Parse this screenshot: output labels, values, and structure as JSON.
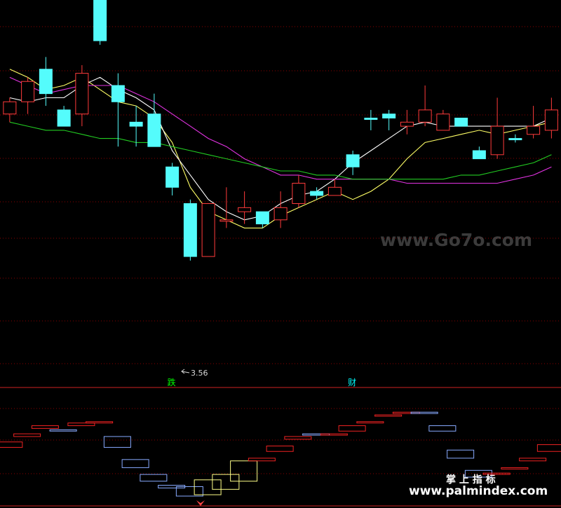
{
  "chart_data": {
    "type": "candlestick",
    "main_panel": {
      "price_range": [
        3.35,
        4.3
      ],
      "min_label": "3.56",
      "grid": true,
      "candles": [
        {
          "o": 4.05,
          "c": 4.02,
          "h": 4.06,
          "l": 4.0,
          "dir": "up"
        },
        {
          "o": 4.05,
          "c": 4.1,
          "h": 4.11,
          "l": 4.02,
          "dir": "up"
        },
        {
          "o": 4.13,
          "c": 4.07,
          "h": 4.16,
          "l": 4.04,
          "dir": "down"
        },
        {
          "o": 4.03,
          "c": 3.99,
          "h": 4.04,
          "l": 3.99,
          "dir": "down"
        },
        {
          "o": 4.02,
          "c": 4.12,
          "h": 4.14,
          "l": 3.99,
          "dir": "up"
        },
        {
          "o": 4.36,
          "c": 4.2,
          "h": 4.36,
          "l": 4.19,
          "dir": "down"
        },
        {
          "o": 4.09,
          "c": 4.05,
          "h": 4.12,
          "l": 3.94,
          "dir": "down"
        },
        {
          "o": 4.0,
          "c": 3.99,
          "h": 4.04,
          "l": 3.94,
          "dir": "down"
        },
        {
          "o": 4.02,
          "c": 3.94,
          "h": 4.07,
          "l": 3.94,
          "dir": "down"
        },
        {
          "o": 3.89,
          "c": 3.84,
          "h": 3.9,
          "l": 3.82,
          "dir": "down"
        },
        {
          "o": 3.8,
          "c": 3.67,
          "h": 3.81,
          "l": 3.66,
          "dir": "down"
        },
        {
          "o": 3.67,
          "c": 3.8,
          "h": 3.8,
          "l": 3.67,
          "dir": "up"
        },
        {
          "o": 3.76,
          "c": 3.76,
          "h": 3.84,
          "l": 3.74,
          "dir": "up"
        },
        {
          "o": 3.78,
          "c": 3.79,
          "h": 3.83,
          "l": 3.75,
          "dir": "up"
        },
        {
          "o": 3.78,
          "c": 3.75,
          "h": 3.78,
          "l": 3.74,
          "dir": "down"
        },
        {
          "o": 3.76,
          "c": 3.79,
          "h": 3.83,
          "l": 3.74,
          "dir": "up"
        },
        {
          "o": 3.8,
          "c": 3.85,
          "h": 3.87,
          "l": 3.79,
          "dir": "up"
        },
        {
          "o": 3.82,
          "c": 3.83,
          "h": 3.84,
          "l": 3.81,
          "dir": "down"
        },
        {
          "o": 3.82,
          "c": 3.84,
          "h": 3.86,
          "l": 3.82,
          "dir": "up"
        },
        {
          "o": 3.92,
          "c": 3.89,
          "h": 3.93,
          "l": 3.87,
          "dir": "down"
        },
        {
          "o": 4.01,
          "c": 4.01,
          "h": 4.03,
          "l": 3.98,
          "dir": "down"
        },
        {
          "o": 4.02,
          "c": 4.01,
          "h": 4.03,
          "l": 3.98,
          "dir": "down"
        },
        {
          "o": 3.99,
          "c": 4.0,
          "h": 4.03,
          "l": 3.97,
          "dir": "up"
        },
        {
          "o": 4.0,
          "c": 4.03,
          "h": 4.09,
          "l": 3.99,
          "dir": "up"
        },
        {
          "o": 3.98,
          "c": 4.02,
          "h": 4.03,
          "l": 3.98,
          "dir": "up"
        },
        {
          "o": 4.01,
          "c": 3.99,
          "h": 4.01,
          "l": 3.99,
          "dir": "down"
        },
        {
          "o": 3.93,
          "c": 3.91,
          "h": 3.94,
          "l": 3.91,
          "dir": "down"
        },
        {
          "o": 3.92,
          "c": 3.99,
          "h": 4.06,
          "l": 3.91,
          "dir": "up"
        },
        {
          "o": 3.96,
          "c": 3.96,
          "h": 3.97,
          "l": 3.95,
          "dir": "down"
        },
        {
          "o": 3.97,
          "c": 3.99,
          "h": 4.04,
          "l": 3.96,
          "dir": "up"
        },
        {
          "o": 3.98,
          "c": 4.03,
          "h": 4.06,
          "l": 3.96,
          "dir": "up"
        }
      ],
      "ma_lines": {
        "yellow": [
          4.13,
          4.11,
          4.08,
          4.09,
          4.11,
          4.08,
          4.05,
          4.04,
          4.01,
          3.95,
          3.84,
          3.78,
          3.76,
          3.74,
          3.74,
          3.77,
          3.79,
          3.81,
          3.83,
          3.81,
          3.83,
          3.86,
          3.91,
          3.95,
          3.96,
          3.97,
          3.98,
          3.97,
          3.98,
          3.99,
          4.0
        ],
        "white": [
          4.06,
          4.05,
          4.06,
          4.06,
          4.09,
          4.11,
          4.08,
          4.06,
          4.03,
          3.93,
          3.87,
          3.81,
          3.78,
          3.76,
          3.77,
          3.8,
          3.82,
          3.83,
          3.86,
          3.9,
          3.93,
          3.96,
          3.99,
          4.0,
          3.99,
          3.99,
          3.99,
          3.99,
          3.99,
          3.99,
          4.01
        ],
        "magenta": [
          4.11,
          4.09,
          4.07,
          4.08,
          4.09,
          4.09,
          4.09,
          4.07,
          4.05,
          4.02,
          3.99,
          3.96,
          3.94,
          3.91,
          3.89,
          3.87,
          3.87,
          3.86,
          3.86,
          3.86,
          3.86,
          3.86,
          3.85,
          3.85,
          3.85,
          3.85,
          3.85,
          3.85,
          3.86,
          3.87,
          3.89
        ],
        "green": [
          4.0,
          3.99,
          3.98,
          3.98,
          3.97,
          3.96,
          3.96,
          3.95,
          3.95,
          3.94,
          3.93,
          3.92,
          3.91,
          3.9,
          3.89,
          3.88,
          3.88,
          3.87,
          3.87,
          3.86,
          3.86,
          3.86,
          3.86,
          3.86,
          3.86,
          3.87,
          3.87,
          3.88,
          3.89,
          3.9,
          3.92
        ]
      },
      "signals": [
        {
          "index": 9,
          "text": "跌",
          "color": "#00ff00"
        },
        {
          "index": 19,
          "text": "财",
          "color": "#00ffff"
        }
      ]
    },
    "indicator_panel": {
      "boxes": [
        {
          "lo": 0.36,
          "hi": 0.4,
          "c": "r"
        },
        {
          "lo": 0.44,
          "hi": 0.46,
          "c": "r"
        },
        {
          "lo": 0.5,
          "hi": 0.52,
          "c": "r"
        },
        {
          "lo": 0.48,
          "hi": 0.49,
          "c": "b"
        },
        {
          "lo": 0.52,
          "hi": 0.54,
          "c": "r"
        },
        {
          "lo": 0.54,
          "hi": 0.55,
          "c": "r"
        },
        {
          "lo": 0.36,
          "hi": 0.44,
          "c": "b"
        },
        {
          "lo": 0.21,
          "hi": 0.27,
          "c": "b"
        },
        {
          "lo": 0.11,
          "hi": 0.16,
          "c": "b"
        },
        {
          "lo": 0.06,
          "hi": 0.08,
          "c": "b"
        },
        {
          "lo": 0.0,
          "hi": 0.07,
          "c": "b"
        },
        {
          "lo": 0.01,
          "hi": 0.12,
          "c": "y"
        },
        {
          "lo": 0.05,
          "hi": 0.16,
          "c": "y"
        },
        {
          "lo": 0.11,
          "hi": 0.26,
          "c": "y"
        },
        {
          "lo": 0.26,
          "hi": 0.28,
          "c": "r"
        },
        {
          "lo": 0.33,
          "hi": 0.37,
          "c": "r"
        },
        {
          "lo": 0.42,
          "hi": 0.44,
          "c": "r"
        },
        {
          "lo": 0.45,
          "hi": 0.46,
          "c": "b"
        },
        {
          "lo": 0.45,
          "hi": 0.46,
          "c": "r"
        },
        {
          "lo": 0.48,
          "hi": 0.52,
          "c": "r"
        },
        {
          "lo": 0.54,
          "hi": 0.55,
          "c": "r"
        },
        {
          "lo": 0.59,
          "hi": 0.6,
          "c": "r"
        },
        {
          "lo": 0.61,
          "hi": 0.62,
          "c": "r"
        },
        {
          "lo": 0.61,
          "hi": 0.62,
          "c": "b"
        },
        {
          "lo": 0.48,
          "hi": 0.52,
          "c": "b"
        },
        {
          "lo": 0.28,
          "hi": 0.34,
          "c": "b"
        },
        {
          "lo": 0.14,
          "hi": 0.19,
          "c": "b"
        },
        {
          "lo": 0.16,
          "hi": 0.17,
          "c": "r"
        },
        {
          "lo": 0.2,
          "hi": 0.21,
          "c": "r"
        },
        {
          "lo": 0.26,
          "hi": 0.28,
          "c": "r"
        },
        {
          "lo": 0.33,
          "hi": 0.38,
          "c": "r"
        }
      ]
    }
  },
  "colors": {
    "up": "#ff3b3b",
    "down": "#54fcfc",
    "yellow": "#ffff66",
    "white": "#ffffff",
    "magenta": "#e233e2",
    "green": "#22cc22",
    "grid": "#8b0000",
    "box_red": "#ee2222",
    "box_blue": "#88aaff",
    "box_yellow": "#ffff88"
  },
  "watermark": {
    "center": "www.Go7o.com",
    "brand": "掌 上 指 标",
    "site": "www.palmindex.com"
  }
}
